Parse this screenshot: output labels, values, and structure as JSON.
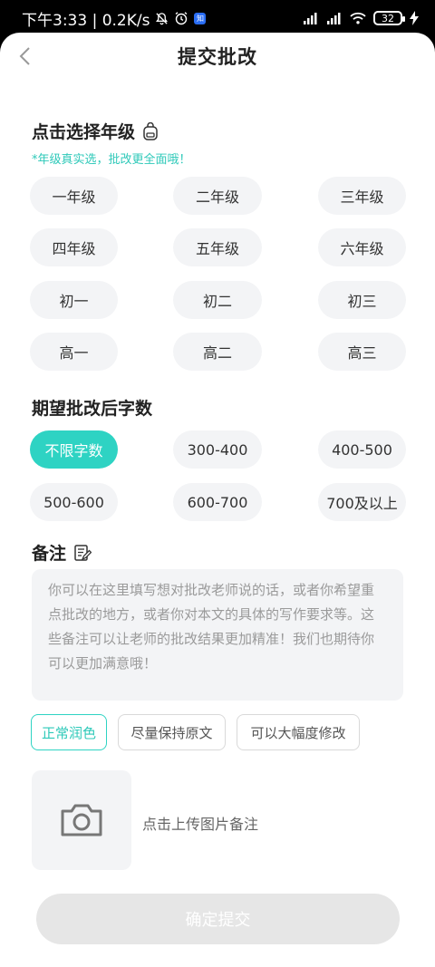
{
  "status_bar": {
    "time_and_speed": "下午3:33 | 0.2K/s",
    "battery": "32"
  },
  "header": {
    "title": "提交批改"
  },
  "grade_section": {
    "title": "点击选择年级",
    "hint": "*年级真实选，批改更全面哦！",
    "options": [
      "一年级",
      "二年级",
      "三年级",
      "四年级",
      "五年级",
      "六年级",
      "初一",
      "初二",
      "初三",
      "高一",
      "高二",
      "高三"
    ]
  },
  "word_count_section": {
    "title": "期望批改后字数",
    "options": [
      "不限字数",
      "300-400",
      "400-500",
      "500-600",
      "600-700",
      "700及以上"
    ],
    "selected": "不限字数"
  },
  "note_section": {
    "title": "备注",
    "placeholder": "你可以在这里填写想对批改老师说的话，或者你希望重点批改的地方，或者你对本文的具体的写作要求等。这些备注可以让老师的批改结果更加精准！我们也期待你可以更加满意哦！",
    "tags": [
      "正常润色",
      "尽量保持原文",
      "可以大幅度修改"
    ],
    "selected_tag": "正常润色"
  },
  "upload": {
    "label": "点击上传图片备注"
  },
  "submit": {
    "label": "确定提交"
  },
  "colors": {
    "accent": "#2ed3c3",
    "hint": "#2ec9b9",
    "pill_bg": "#f3f4f6"
  }
}
